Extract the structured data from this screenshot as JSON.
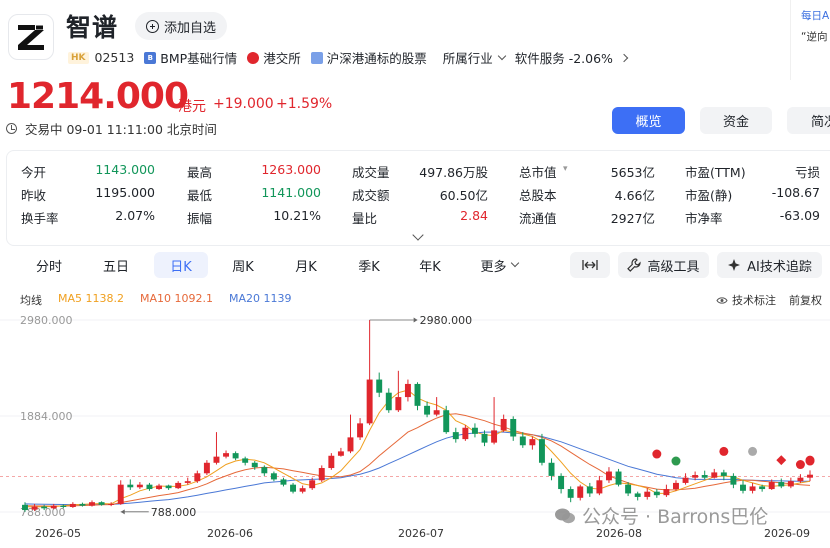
{
  "header": {
    "name": "智谱",
    "watch_label": "添加自选",
    "market_tag": "HK",
    "code": "02513",
    "tags": [
      "BMP基础行情",
      "港交所",
      "沪深港通标的股票"
    ],
    "industry_label": "所属行业",
    "sector": "软件服务 -2.06%"
  },
  "promo": {
    "line1": "每日A",
    "line2": "“逆向"
  },
  "quote": {
    "price": "1214.000",
    "unit": "港元",
    "change": "+19.000",
    "change_pct": "+1.59%",
    "status": "交易中 09-01 11:11:00 北京时间"
  },
  "top_tabs": [
    "概览",
    "资金",
    "简况"
  ],
  "stats": [
    [
      {
        "l": "今开",
        "v": "1143.000",
        "c": "green"
      },
      {
        "l": "最高",
        "v": "1263.000",
        "c": "red"
      },
      {
        "l": "成交量",
        "v": "497.86万股"
      },
      {
        "l": "总市值",
        "v": "5653亿"
      },
      {
        "l": "市盈(TTM)",
        "v": "亏损"
      }
    ],
    [
      {
        "l": "昨收",
        "v": "1195.000"
      },
      {
        "l": "最低",
        "v": "1141.000",
        "c": "green"
      },
      {
        "l": "成交额",
        "v": "60.50亿"
      },
      {
        "l": "总股本",
        "v": "4.66亿"
      },
      {
        "l": "市盈(静)",
        "v": "-108.67"
      }
    ],
    [
      {
        "l": "换手率",
        "v": "2.07%"
      },
      {
        "l": "振幅",
        "v": "10.21%"
      },
      {
        "l": "量比",
        "v": "2.84",
        "c": "red"
      },
      {
        "l": "流通值",
        "v": "2927亿"
      },
      {
        "l": "市净率",
        "v": "-63.09"
      }
    ]
  ],
  "periods": [
    "分时",
    "五日",
    "日K",
    "周K",
    "月K",
    "季K",
    "年K",
    "更多"
  ],
  "tools": {
    "expand_icon": "expand-horizontal-icon",
    "advanced": "高级工具",
    "ai": "AI技术追踪"
  },
  "ma": {
    "label": "均线",
    "ma5": "MA5 1138.2",
    "ma10": "MA10 1092.1",
    "ma20": "MA20 1139"
  },
  "indicator_label": "技术标注",
  "adjust_label": "前复权",
  "watermark": "公众号 · Barrons巴伦",
  "colors": {
    "up": "#e0262d",
    "down": "#12965a",
    "ma5": "#f0a020",
    "ma10": "#e6693a",
    "ma20": "#4a78d6",
    "accent": "#3d6ff5"
  },
  "chart_data": {
    "type": "candlestick",
    "y_ticks": [
      "2980.000",
      "1884.000",
      "788.000"
    ],
    "ylim": [
      788,
      2980
    ],
    "x_ticks": [
      "2026-05",
      "2026-06",
      "2026-07",
      "2026-08",
      "2026-09"
    ],
    "annotations": [
      {
        "label": "2980.000",
        "kind": "high"
      },
      {
        "label": "788.000",
        "kind": "low"
      }
    ],
    "reference_price": 1195,
    "candles": [
      [
        870,
        810,
        900,
        790
      ],
      [
        815,
        850,
        880,
        800
      ],
      [
        850,
        830,
        870,
        810
      ],
      [
        830,
        860,
        880,
        820
      ],
      [
        860,
        845,
        875,
        830
      ],
      [
        845,
        880,
        900,
        835
      ],
      [
        880,
        860,
        895,
        850
      ],
      [
        860,
        900,
        920,
        850
      ],
      [
        900,
        870,
        910,
        860
      ],
      [
        870,
        880,
        900,
        855
      ],
      [
        880,
        1100,
        1150,
        870
      ],
      [
        1100,
        1070,
        1160,
        1040
      ],
      [
        1070,
        1100,
        1130,
        1050
      ],
      [
        1100,
        1050,
        1120,
        1030
      ],
      [
        1050,
        1090,
        1110,
        1040
      ],
      [
        1090,
        1060,
        1100,
        1040
      ],
      [
        1060,
        1120,
        1140,
        1050
      ],
      [
        1120,
        1140,
        1180,
        1100
      ],
      [
        1140,
        1230,
        1260,
        1120
      ],
      [
        1230,
        1350,
        1380,
        1210
      ],
      [
        1350,
        1420,
        1700,
        1330
      ],
      [
        1420,
        1460,
        1490,
        1400
      ],
      [
        1460,
        1400,
        1480,
        1380
      ],
      [
        1400,
        1350,
        1420,
        1320
      ],
      [
        1350,
        1300,
        1370,
        1270
      ],
      [
        1300,
        1230,
        1320,
        1200
      ],
      [
        1230,
        1160,
        1250,
        1140
      ],
      [
        1160,
        1100,
        1180,
        1080
      ],
      [
        1100,
        1020,
        1120,
        1000
      ],
      [
        1020,
        1060,
        1090,
        1000
      ],
      [
        1060,
        1150,
        1180,
        1040
      ],
      [
        1150,
        1290,
        1320,
        1130
      ],
      [
        1290,
        1430,
        1460,
        1270
      ],
      [
        1430,
        1480,
        1520,
        1420
      ],
      [
        1480,
        1640,
        1900,
        1460
      ],
      [
        1640,
        1800,
        1860,
        1610
      ],
      [
        1800,
        2300,
        2980,
        1780
      ],
      [
        2300,
        2150,
        2380,
        2100
      ],
      [
        2150,
        1950,
        2200,
        1920
      ],
      [
        1950,
        2100,
        2400,
        1930
      ],
      [
        2100,
        2250,
        2300,
        2050
      ],
      [
        2250,
        2000,
        2270,
        1950
      ],
      [
        2000,
        1900,
        2050,
        1870
      ],
      [
        1900,
        1950,
        2100,
        1880
      ],
      [
        1950,
        1700,
        2000,
        1680
      ],
      [
        1700,
        1620,
        1750,
        1580
      ],
      [
        1620,
        1750,
        1780,
        1600
      ],
      [
        1750,
        1680,
        1800,
        1640
      ],
      [
        1680,
        1580,
        1720,
        1540
      ],
      [
        1580,
        1720,
        2100,
        1560
      ],
      [
        1720,
        1850,
        1900,
        1700
      ],
      [
        1850,
        1650,
        1880,
        1600
      ],
      [
        1650,
        1550,
        1700,
        1520
      ],
      [
        1550,
        1620,
        1650,
        1500
      ],
      [
        1620,
        1350,
        1680,
        1320
      ],
      [
        1350,
        1200,
        1400,
        1150
      ],
      [
        1200,
        1050,
        1230,
        1000
      ],
      [
        1050,
        950,
        1080,
        900
      ],
      [
        950,
        1080,
        1100,
        920
      ],
      [
        1080,
        1000,
        1120,
        960
      ],
      [
        1000,
        1150,
        1200,
        980
      ],
      [
        1150,
        1250,
        1300,
        1120
      ],
      [
        1250,
        1100,
        1280,
        1080
      ],
      [
        1100,
        1000,
        1130,
        970
      ],
      [
        1000,
        960,
        1020,
        920
      ],
      [
        960,
        1020,
        1060,
        930
      ],
      [
        1020,
        980,
        1050,
        950
      ],
      [
        980,
        1050,
        1100,
        960
      ],
      [
        1050,
        1120,
        1150,
        1030
      ],
      [
        1120,
        1180,
        1230,
        1100
      ],
      [
        1180,
        1210,
        1250,
        1150
      ],
      [
        1210,
        1180,
        1260,
        1160
      ],
      [
        1180,
        1240,
        1280,
        1170
      ],
      [
        1240,
        1200,
        1270,
        1150
      ],
      [
        1200,
        1100,
        1230,
        1060
      ],
      [
        1100,
        1030,
        1150,
        1000
      ],
      [
        1030,
        1080,
        1120,
        1000
      ],
      [
        1080,
        1050,
        1100,
        1020
      ],
      [
        1050,
        1130,
        1160,
        1040
      ],
      [
        1130,
        1080,
        1170,
        1060
      ],
      [
        1080,
        1140,
        1180,
        1060
      ],
      [
        1140,
        1180,
        1220,
        1120
      ],
      [
        1180,
        1214,
        1263,
        1141
      ]
    ],
    "ma5": [
      850,
      845,
      850,
      850,
      860,
      870,
      875,
      880,
      885,
      880,
      940,
      980,
      1030,
      1060,
      1085,
      1080,
      1080,
      1100,
      1140,
      1190,
      1260,
      1330,
      1370,
      1390,
      1380,
      1350,
      1290,
      1230,
      1170,
      1110,
      1090,
      1120,
      1180,
      1260,
      1380,
      1500,
      1720,
      1920,
      2060,
      2150,
      2180,
      2090,
      2040,
      2010,
      1950,
      1830,
      1780,
      1700,
      1670,
      1660,
      1720,
      1700,
      1680,
      1650,
      1590,
      1480,
      1360,
      1230,
      1130,
      1060,
      1050,
      1090,
      1120,
      1110,
      1090,
      1060,
      1000,
      1000,
      1030,
      1070,
      1110,
      1150,
      1190,
      1200,
      1190,
      1150,
      1120,
      1090,
      1080,
      1090,
      1100,
      1120,
      1138
    ],
    "ma10": [
      860,
      858,
      856,
      855,
      856,
      858,
      862,
      866,
      870,
      872,
      895,
      915,
      935,
      955,
      975,
      990,
      1010,
      1040,
      1070,
      1110,
      1160,
      1200,
      1240,
      1270,
      1290,
      1300,
      1290,
      1280,
      1260,
      1240,
      1220,
      1200,
      1190,
      1190,
      1210,
      1250,
      1330,
      1430,
      1520,
      1610,
      1700,
      1750,
      1810,
      1860,
      1900,
      1910,
      1890,
      1860,
      1830,
      1790,
      1760,
      1720,
      1690,
      1670,
      1640,
      1600,
      1540,
      1470,
      1400,
      1330,
      1270,
      1200,
      1160,
      1120,
      1090,
      1070,
      1050,
      1040,
      1040,
      1050,
      1060,
      1080,
      1100,
      1120,
      1140,
      1150,
      1150,
      1140,
      1130,
      1120,
      1110,
      1100,
      1092
    ],
    "ma20": [
      880,
      878,
      876,
      875,
      874,
      873,
      873,
      873,
      874,
      875,
      880,
      890,
      900,
      910,
      920,
      930,
      945,
      960,
      980,
      1000,
      1020,
      1040,
      1060,
      1080,
      1100,
      1120,
      1130,
      1140,
      1150,
      1155,
      1160,
      1165,
      1170,
      1180,
      1200,
      1220,
      1250,
      1290,
      1340,
      1390,
      1440,
      1490,
      1540,
      1590,
      1630,
      1660,
      1680,
      1690,
      1700,
      1700,
      1700,
      1690,
      1680,
      1670,
      1650,
      1620,
      1590,
      1550,
      1510,
      1470,
      1430,
      1390,
      1350,
      1310,
      1280,
      1250,
      1220,
      1200,
      1180,
      1170,
      1160,
      1160,
      1160,
      1160,
      1160,
      1155,
      1150,
      1148,
      1145,
      1143,
      1141,
      1140,
      1139
    ]
  }
}
